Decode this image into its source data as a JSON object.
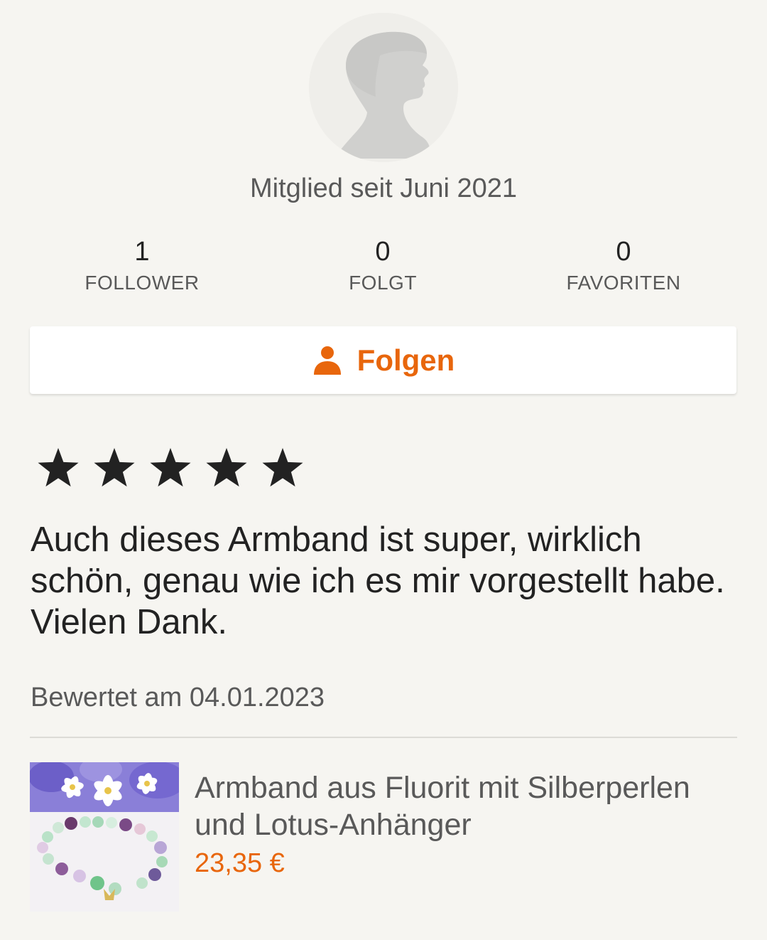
{
  "profile": {
    "member_since": "Mitglied seit Juni 2021"
  },
  "stats": [
    {
      "value": "1",
      "label": "FOLLOWER"
    },
    {
      "value": "0",
      "label": "FOLGT"
    },
    {
      "value": "0",
      "label": "FAVORITEN"
    }
  ],
  "follow_button": {
    "label": "Folgen",
    "icon": "person-icon"
  },
  "review": {
    "rating": 5,
    "max_rating": 5,
    "text": "Auch dieses Armband ist super, wirklich schön, genau wie ich es mir vorgestellt habe. Vielen Dank.",
    "date": "Bewertet am 04.01.2023"
  },
  "product": {
    "title": "Armband aus Fluorit mit Silberperlen und Lotus-Anhänger",
    "price": "23,35 €"
  },
  "colors": {
    "accent": "#e8660c",
    "background": "#f6f5f1",
    "text": "#222222",
    "muted_text": "#595959"
  }
}
